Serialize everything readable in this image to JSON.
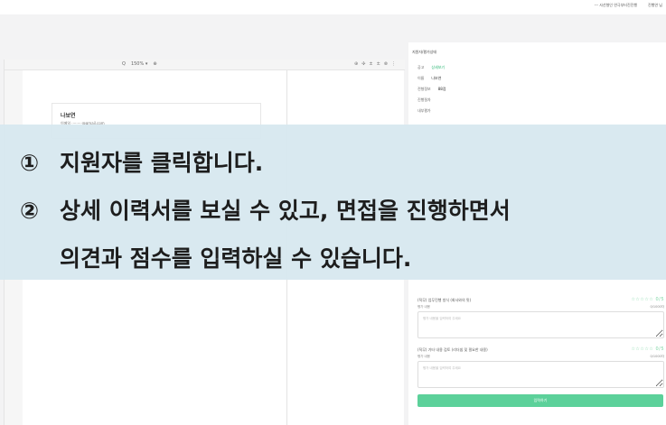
{
  "topbar": {
    "links": [
      "--- 사선형인 연극부터진진행",
      "진행연 님"
    ]
  },
  "viewer": {
    "zoom_level": "150% ▾",
    "zoom_out": "Q",
    "zoom_in": "⊕",
    "tools": [
      "⊕",
      "✣",
      "±",
      "±",
      "⊗",
      "⋮"
    ],
    "resume_name": "나보연",
    "resume_email": "이메일 ·········@gmail.com"
  },
  "panel": {
    "title": "지원자/평가상태",
    "fields": [
      {
        "label": "공고",
        "value": "상세보기",
        "link": true
      },
      {
        "label": "이름",
        "value": "나보연",
        "link": false
      },
      {
        "label": "전형정보",
        "value": "88점",
        "link": false
      },
      {
        "label": "진행절차",
        "value": "",
        "link": false
      },
      {
        "label": "내부평가",
        "value": "",
        "link": false
      }
    ],
    "evaluations": [
      {
        "label": "(직무) 업무진행 방식 (회사와의 핏)",
        "stars": "☆☆☆☆☆",
        "score": "0/5",
        "sub_label": "평가 내용",
        "sub_right": "0/1000자",
        "placeholder": "평가 내용을 입력하여 주세요"
      },
      {
        "label": "(직무) 기타 내용 검토 (리더쉽 및 필요한 내용)",
        "stars": "☆☆☆☆☆",
        "score": "0/5",
        "sub_label": "평가 내용",
        "sub_right": "0/1000자",
        "placeholder": "평가 내용을 입력하여 주세요"
      }
    ],
    "submit_label": "입력하기"
  },
  "overlay": {
    "step1_num": "①",
    "step1_text": "지원자를 클릭합니다.",
    "step2_num": "②",
    "step2_text": "상세 이력서를 보실 수 있고, 면접을 진행하면서",
    "step2_text_cont": "의견과 점수를 입력하실 수 있습니다."
  }
}
